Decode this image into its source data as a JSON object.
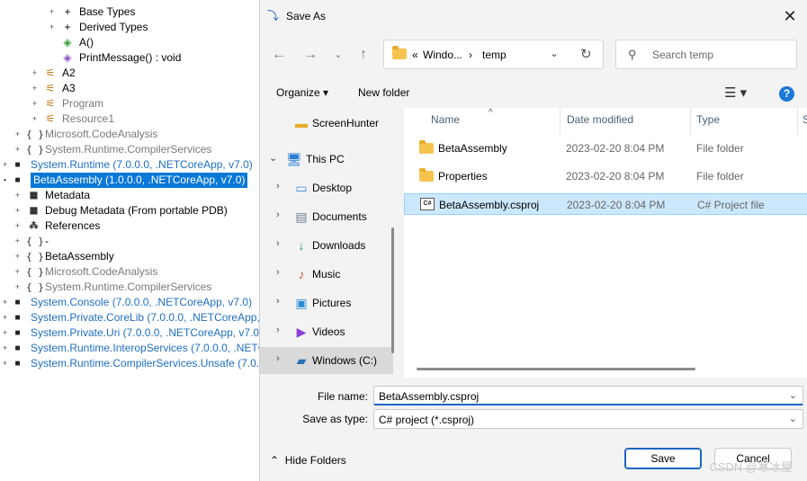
{
  "tree": {
    "rows": [
      {
        "label": "Base Types",
        "exp": "+",
        "icon": "+",
        "style": ""
      },
      {
        "label": "Derived Types",
        "exp": "+",
        "icon": "+",
        "style": ""
      },
      {
        "label": "A()",
        "exp": "",
        "icon": "◈",
        "style": ""
      },
      {
        "label": "PrintMessage() : void",
        "exp": "",
        "icon": "◈",
        "style": ""
      },
      {
        "label": "A2",
        "exp": "+",
        "icon": "⚟",
        "style": ""
      },
      {
        "label": "A3",
        "exp": "+",
        "icon": "⚟",
        "style": ""
      },
      {
        "label": "Program",
        "exp": "+",
        "icon": "⚟",
        "style": "gray"
      },
      {
        "label": "Resource1",
        "exp": "+",
        "icon": "⚟",
        "style": "gray"
      },
      {
        "label": "Microsoft.CodeAnalysis",
        "exp": "+",
        "icon": "{ }",
        "style": "gray"
      },
      {
        "label": "System.Runtime.CompilerServices",
        "exp": "+",
        "icon": "{ }",
        "style": "gray"
      },
      {
        "label": "System.Runtime (7.0.0.0, .NETCoreApp, v7.0)",
        "exp": "+",
        "icon": "■",
        "style": "blue"
      },
      {
        "label": "BetaAssembly (1.0.0.0, .NETCoreApp, v7.0)",
        "exp": "-",
        "icon": "■",
        "style": "sel"
      },
      {
        "label": "Metadata",
        "exp": "+",
        "icon": "▦",
        "style": ""
      },
      {
        "label": "Debug Metadata (From portable PDB)",
        "exp": "+",
        "icon": "▦",
        "style": ""
      },
      {
        "label": "References",
        "exp": "+",
        "icon": "⁂",
        "style": ""
      },
      {
        "label": "-",
        "exp": "+",
        "icon": "{ }",
        "style": ""
      },
      {
        "label": "BetaAssembly",
        "exp": "+",
        "icon": "{ }",
        "style": ""
      },
      {
        "label": "Microsoft.CodeAnalysis",
        "exp": "+",
        "icon": "{ }",
        "style": "gray"
      },
      {
        "label": "System.Runtime.CompilerServices",
        "exp": "+",
        "icon": "{ }",
        "style": "gray"
      },
      {
        "label": "System.Console (7.0.0.0, .NETCoreApp, v7.0)",
        "exp": "+",
        "icon": "■",
        "style": "blue"
      },
      {
        "label": "System.Private.CoreLib (7.0.0.0, .NETCoreApp, v7",
        "exp": "+",
        "icon": "■",
        "style": "blue"
      },
      {
        "label": "System.Private.Uri (7.0.0.0, .NETCoreApp, v7.0)",
        "exp": "+",
        "icon": "■",
        "style": "blue"
      },
      {
        "label": "System.Runtime.InteropServices (7.0.0.0, .NETCo",
        "exp": "+",
        "icon": "■",
        "style": "blue"
      },
      {
        "label": "System.Runtime.CompilerServices.Unsafe (7.0.0.0",
        "exp": "+",
        "icon": "■",
        "style": "blue"
      }
    ]
  },
  "dialog": {
    "title": "Save As",
    "address": {
      "prefix": "«",
      "crumb1": "Windo...",
      "sep": "›",
      "crumb2": "temp"
    },
    "search_placeholder": "Search temp",
    "organize": "Organize ▾",
    "new_folder": "New folder",
    "help": "?",
    "nav": [
      {
        "label": "ScreenHunter",
        "icon": "folder-icon",
        "glyph": "▬",
        "chev": "",
        "selected": false
      },
      {
        "label": "This PC",
        "icon": "monitor-icon",
        "glyph": "🖥",
        "chev": "⌄",
        "selected": false
      },
      {
        "label": "Desktop",
        "icon": "desktop-icon",
        "glyph": "▭",
        "chev": "›",
        "selected": false
      },
      {
        "label": "Documents",
        "icon": "documents-icon",
        "glyph": "▤",
        "chev": "›",
        "selected": false
      },
      {
        "label": "Downloads",
        "icon": "download-icon",
        "glyph": "↓",
        "chev": "›",
        "selected": false
      },
      {
        "label": "Music",
        "icon": "music-icon",
        "glyph": "♪",
        "chev": "›",
        "selected": false
      },
      {
        "label": "Pictures",
        "icon": "pictures-icon",
        "glyph": "▣",
        "chev": "›",
        "selected": false
      },
      {
        "label": "Videos",
        "icon": "videos-icon",
        "glyph": "▶",
        "chev": "›",
        "selected": false
      },
      {
        "label": "Windows (C:)",
        "icon": "drive-icon",
        "glyph": "▰",
        "chev": "›",
        "selected": true
      }
    ],
    "columns": {
      "name": "Name",
      "date": "Date modified",
      "type": "Type",
      "size": "S"
    },
    "files": [
      {
        "name": "BetaAssembly",
        "date": "2023-02-20 8:04 PM",
        "type": "File folder",
        "kind": "folder"
      },
      {
        "name": "Properties",
        "date": "2023-02-20 8:04 PM",
        "type": "File folder",
        "kind": "folder"
      },
      {
        "name": "BetaAssembly.csproj",
        "date": "2023-02-20 8:04 PM",
        "type": "C# Project file",
        "kind": "csproj"
      }
    ],
    "file_name_label": "File name:",
    "file_name_value": "BetaAssembly.csproj",
    "save_type_label": "Save as type:",
    "save_type_value": "C# project (*.csproj)",
    "hide_folders": "Hide Folders",
    "save_label": "Save",
    "cancel_label": "Cancel"
  },
  "watermark": "CSDN @寒冰屋"
}
